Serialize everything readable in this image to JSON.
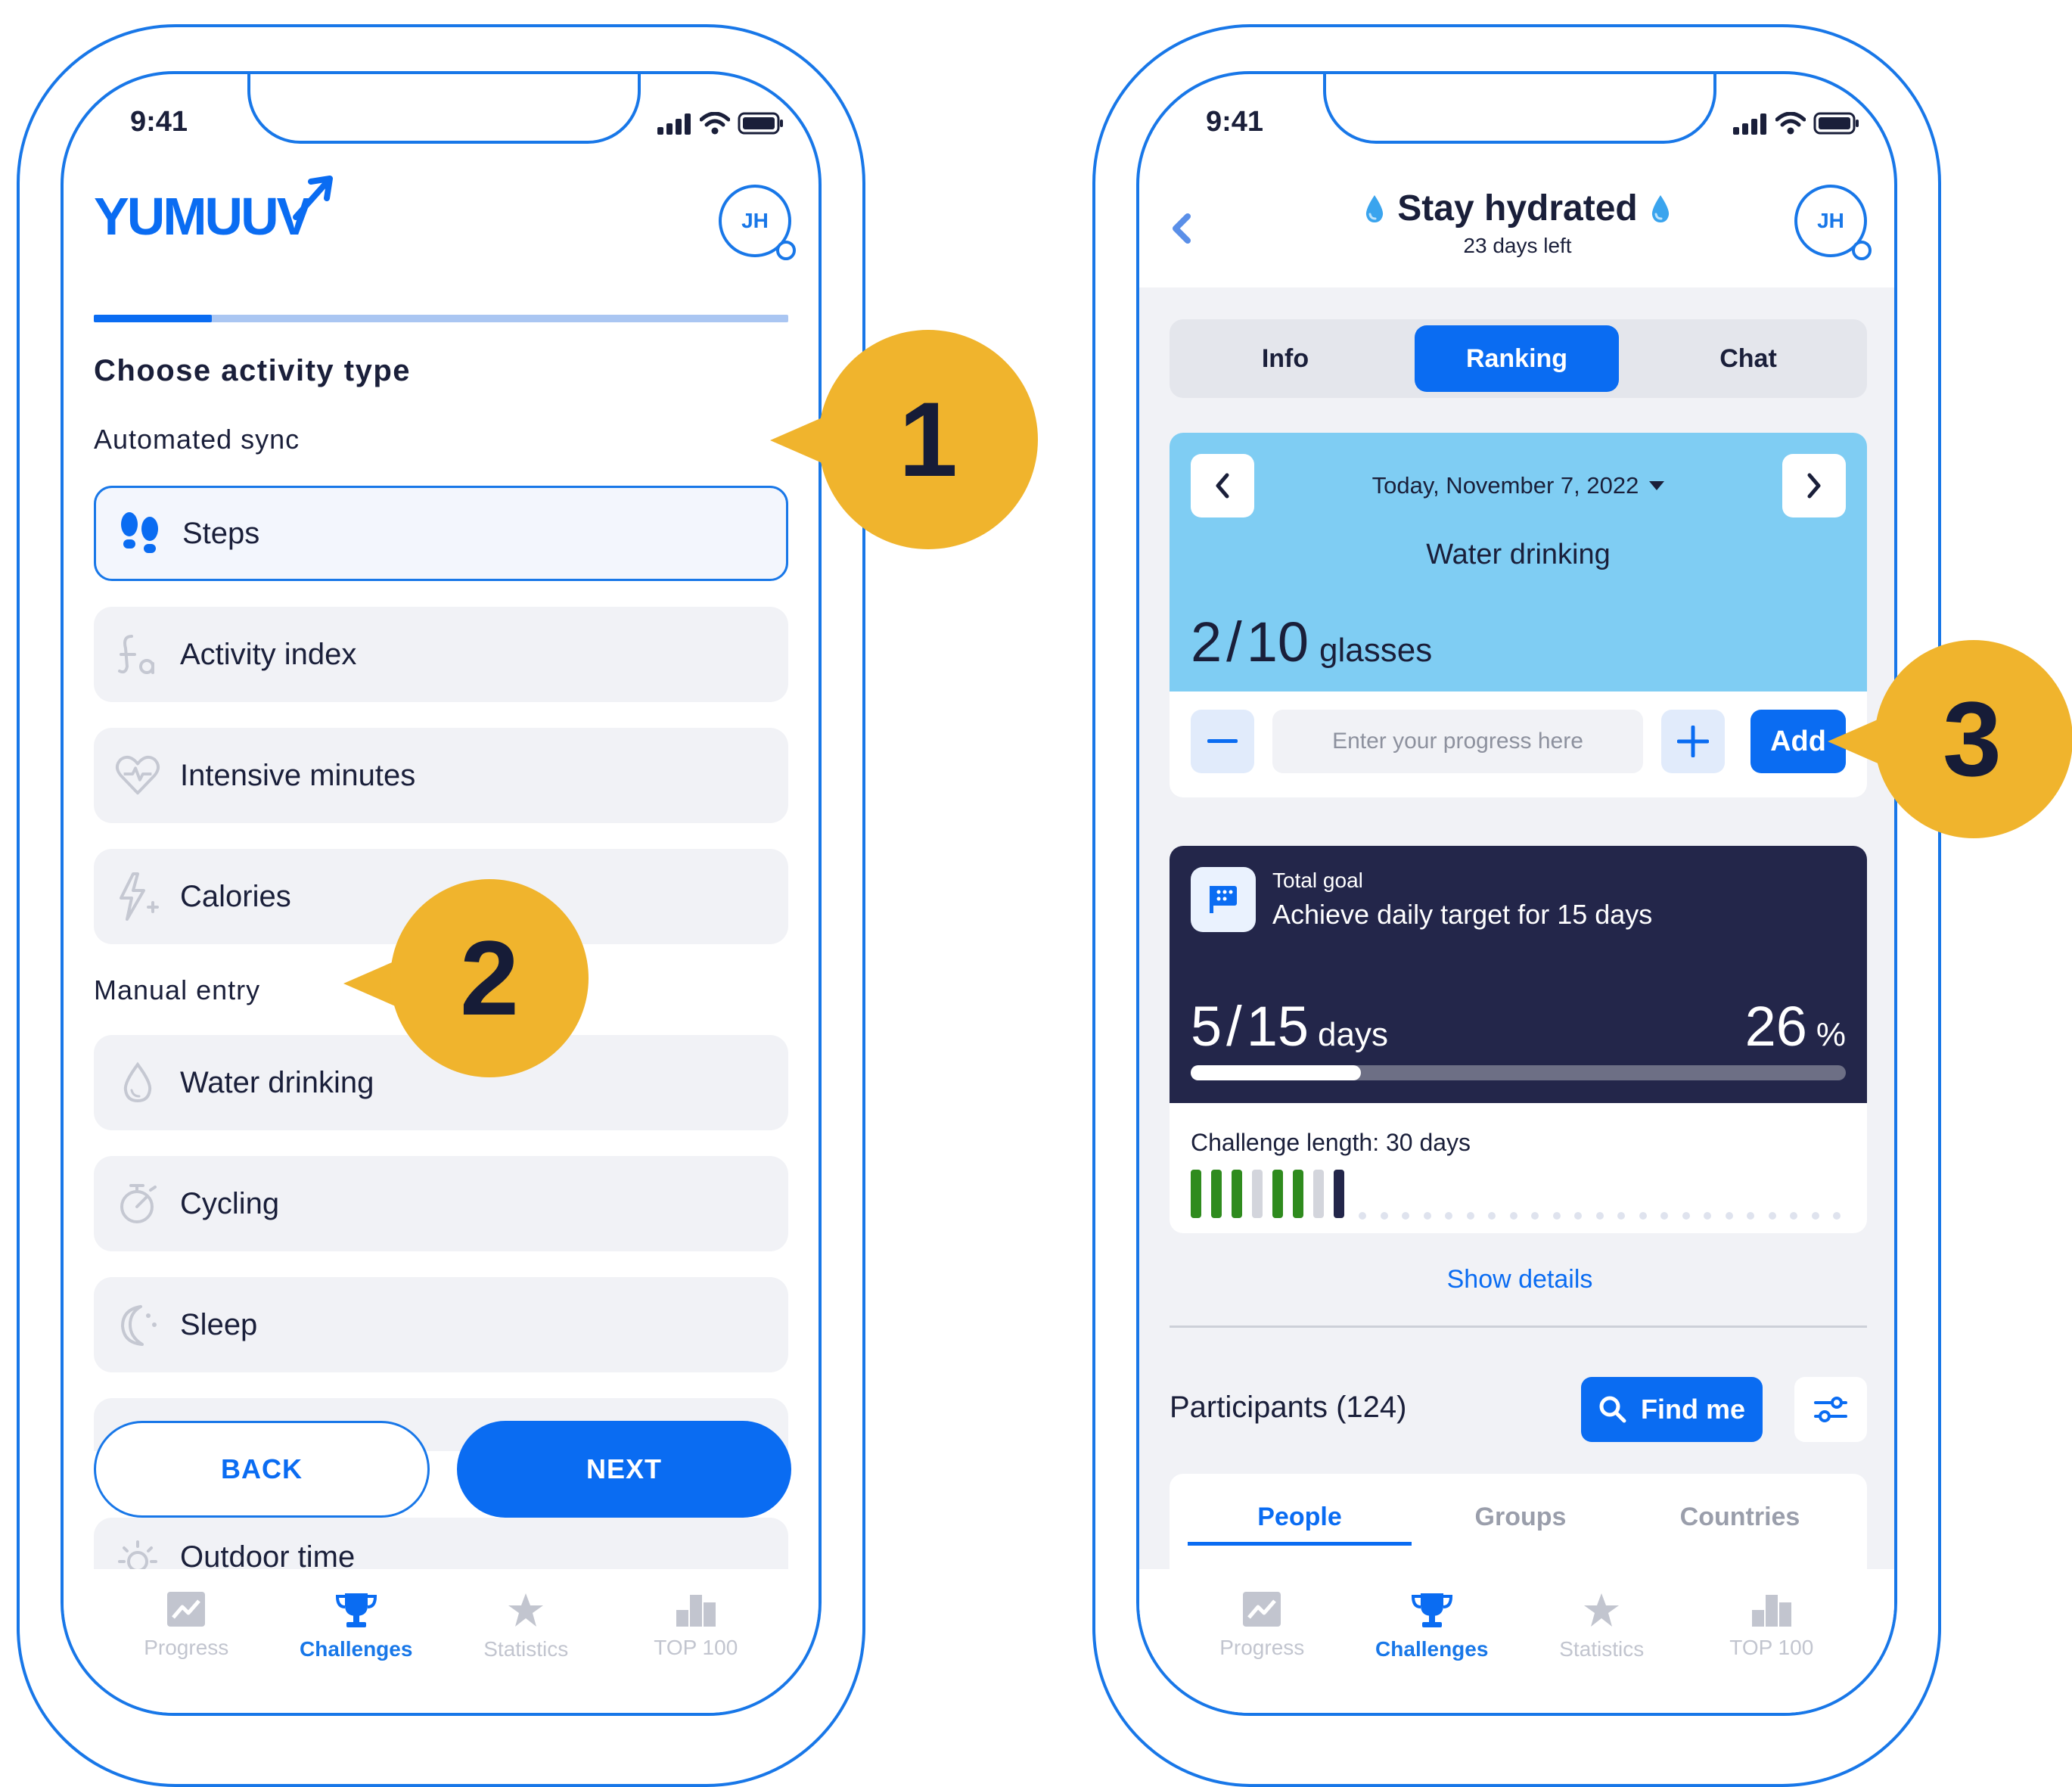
{
  "left_phone": {
    "time": "9:41",
    "logo": "YUMUUV",
    "avatar_initials": "JH",
    "progress_fraction": 0.17,
    "heading": "Choose activity type",
    "automated_sync_label": "Automated sync",
    "manual_entry_label": "Manual entry",
    "automated_items": [
      {
        "label": "Steps",
        "icon": "footsteps-icon",
        "selected": true
      },
      {
        "label": "Activity index",
        "icon": "activity-index-icon",
        "selected": false
      },
      {
        "label": "Intensive minutes",
        "icon": "heart-pulse-icon",
        "selected": false
      },
      {
        "label": "Calories",
        "icon": "lightning-plus-icon",
        "selected": false
      }
    ],
    "manual_items": [
      {
        "label": "Water drinking",
        "icon": "water-drop-icon"
      },
      {
        "label": "Cycling",
        "icon": "stopwatch-icon"
      },
      {
        "label": "Sleep",
        "icon": "moon-icon"
      },
      {
        "label": "Outdoor time",
        "icon": "sun-icon"
      }
    ],
    "back_label": "BACK",
    "next_label": "NEXT"
  },
  "right_phone": {
    "time": "9:41",
    "title": "Stay hydrated",
    "days_left": "23 days left",
    "avatar_initials": "JH",
    "tabs": [
      "Info",
      "Ranking",
      "Chat"
    ],
    "active_tab": "Ranking",
    "date_label": "Today, November 7, 2022",
    "activity_name": "Water drinking",
    "progress_current": "2",
    "progress_target": "10",
    "progress_unit": "glasses",
    "input_placeholder": "Enter your progress here",
    "add_label": "Add",
    "goal_caption": "Total goal",
    "goal_text": "Achieve daily target for 15 days",
    "goal_current": "5",
    "goal_target": "15",
    "goal_unit": "days",
    "goal_percent": "26",
    "goal_percent_sign": "%",
    "goal_fraction": 0.26,
    "challenge_length": "Challenge length: 30 days",
    "day_bars": [
      "done",
      "done",
      "done",
      "missed",
      "done",
      "done",
      "missed",
      "today"
    ],
    "future_days": 23,
    "show_details": "Show details",
    "participants_label": "Participants (124)",
    "find_me_label": "Find me",
    "participant_tabs": [
      "People",
      "Groups",
      "Countries"
    ],
    "active_participant_tab": "People"
  },
  "bottom_tabs": [
    {
      "label": "Progress",
      "icon": "chart-icon",
      "active": false
    },
    {
      "label": "Challenges",
      "icon": "trophy-icon",
      "active": true
    },
    {
      "label": "Statistics",
      "icon": "star-icon",
      "active": false
    },
    {
      "label": "TOP 100",
      "icon": "podium-icon",
      "active": false
    }
  ],
  "callouts": [
    "1",
    "2",
    "3"
  ],
  "colors": {
    "accent": "#0a6cf2",
    "outline": "#1877e8",
    "callout": "#f0b42d",
    "navy": "#23264a",
    "sky": "#7fcdf3",
    "done_green": "#2f8b1e"
  }
}
